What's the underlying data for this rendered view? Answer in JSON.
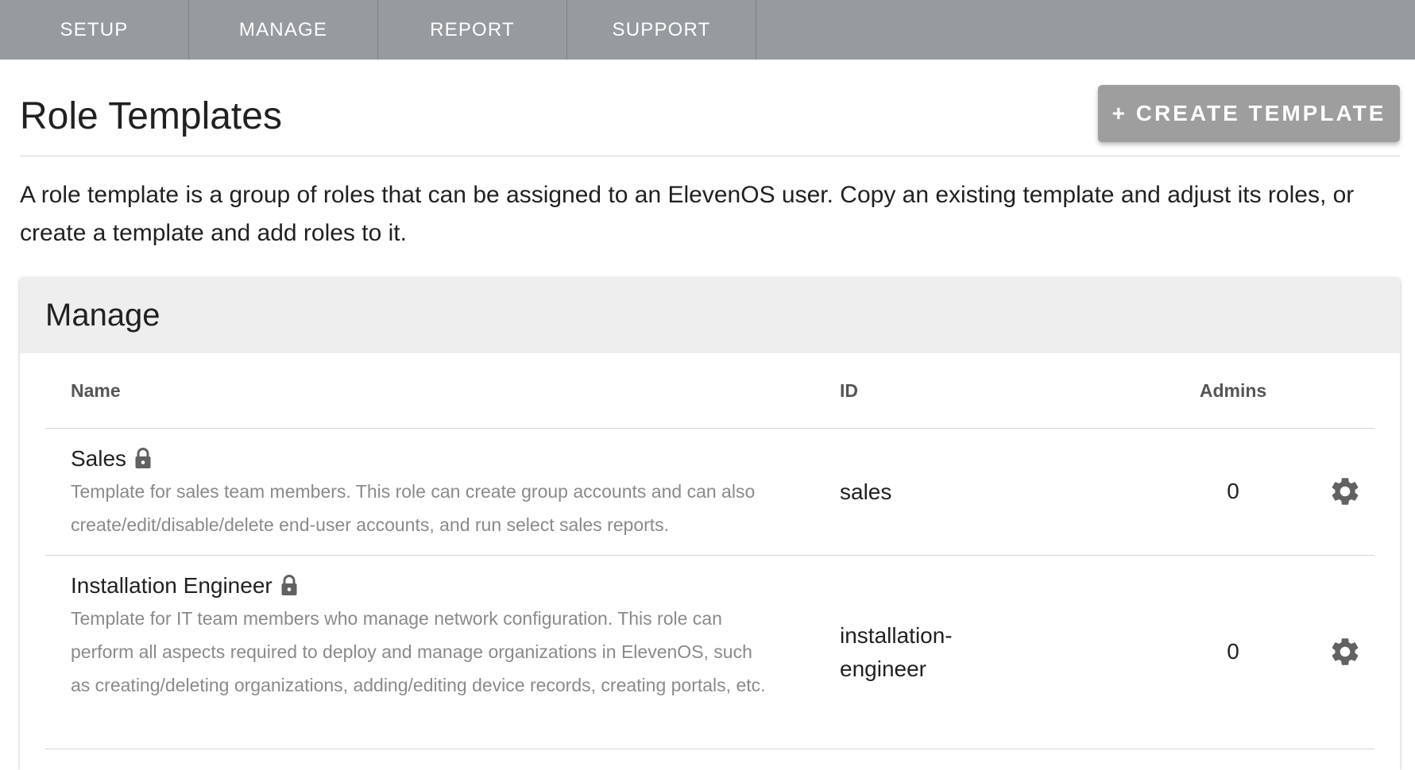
{
  "nav": {
    "tabs": [
      {
        "label": "SETUP"
      },
      {
        "label": "MANAGE"
      },
      {
        "label": "REPORT"
      },
      {
        "label": "SUPPORT"
      }
    ]
  },
  "header": {
    "title": "Role Templates",
    "create_button_label": "+ CREATE TEMPLATE"
  },
  "description": "A role template is a group of roles that can be assigned to an ElevenOS user. Copy an existing template and adjust its roles, or create a template and add roles to it.",
  "card": {
    "title": "Manage",
    "columns": {
      "name": "Name",
      "id": "ID",
      "admins": "Admins"
    },
    "rows": [
      {
        "name": "Sales",
        "description": "Template for sales team members. This role can create group accounts and can also create/edit/disable/delete end-user accounts, and run select sales reports.",
        "id": "sales",
        "admins": "0",
        "icons": {
          "lock": "lock-icon",
          "settings": "gear-icon"
        }
      },
      {
        "name": "Installation Engineer",
        "description": "Template for IT team members who manage network configuration. This role can perform all aspects required to deploy and manage organizations in ElevenOS, such as creating/deleting organizations, adding/editing device records, creating portals, etc.",
        "id": "installation-engineer",
        "admins": "0",
        "icons": {
          "lock": "lock-icon",
          "settings": "gear-icon"
        }
      }
    ]
  },
  "colors": {
    "nav_background": "#969b9f",
    "button_background": "#9e9e9e",
    "card_header_background": "#eeeeee",
    "icon_color": "#616161",
    "muted_text": "#8a8a8a"
  }
}
